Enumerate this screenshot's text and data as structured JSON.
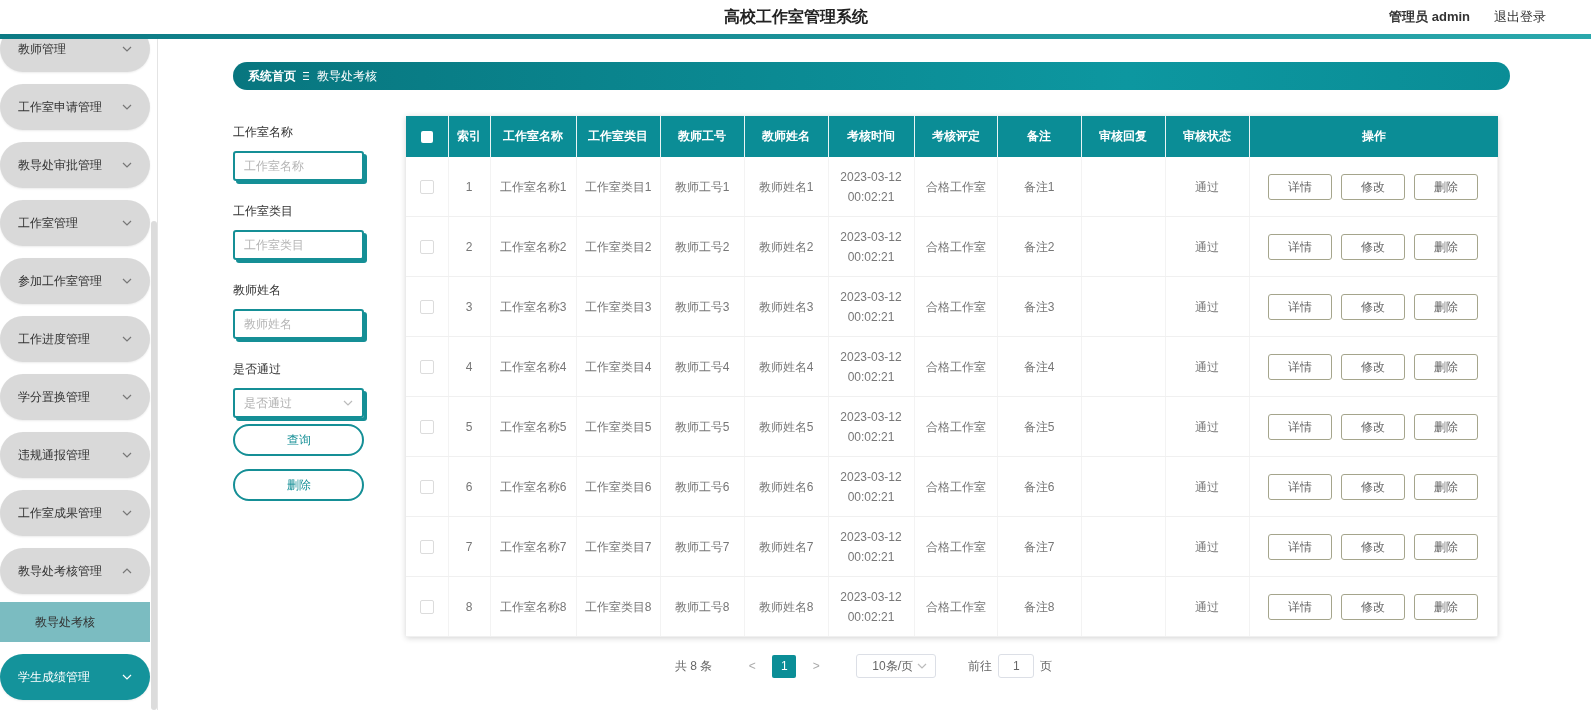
{
  "header": {
    "title": "高校工作室管理系统",
    "user": "管理员 admin",
    "logout": "退出登录"
  },
  "sidebar": {
    "items": [
      {
        "label": "教师管理",
        "expanded": false,
        "selected": false
      },
      {
        "label": "工作室申请管理",
        "expanded": false,
        "selected": false
      },
      {
        "label": "教导处审批管理",
        "expanded": false,
        "selected": false
      },
      {
        "label": "工作室管理",
        "expanded": false,
        "selected": false
      },
      {
        "label": "参加工作室管理",
        "expanded": false,
        "selected": false
      },
      {
        "label": "工作进度管理",
        "expanded": false,
        "selected": false
      },
      {
        "label": "学分置换管理",
        "expanded": false,
        "selected": false
      },
      {
        "label": "违规通报管理",
        "expanded": false,
        "selected": false
      },
      {
        "label": "工作室成果管理",
        "expanded": false,
        "selected": false
      },
      {
        "label": "教导处考核管理",
        "expanded": true,
        "selected": false,
        "children": [
          {
            "label": "教导处考核",
            "selected": true
          }
        ]
      },
      {
        "label": "学生成绩管理",
        "expanded": false,
        "selected": true
      }
    ]
  },
  "breadcrumb": [
    "系统首页",
    "教导处考核"
  ],
  "filters": [
    {
      "kind": "input",
      "label": "工作室名称",
      "placeholder": "工作室名称"
    },
    {
      "kind": "input",
      "label": "工作室类目",
      "placeholder": "工作室类目"
    },
    {
      "kind": "input",
      "label": "教师姓名",
      "placeholder": "教师姓名"
    },
    {
      "kind": "select",
      "label": "是否通过",
      "placeholder": "是否通过"
    }
  ],
  "filter_buttons": [
    "查询",
    "删除"
  ],
  "table": {
    "select_all": {
      "checked": false
    },
    "columns": [
      "索引",
      "工作室名称",
      "工作室类目",
      "教师工号",
      "教师姓名",
      "考核时间",
      "考核评定",
      "备注",
      "审核回复",
      "审核状态",
      "操作"
    ],
    "rows": [
      {
        "checked": false,
        "cells": [
          "1",
          "工作室名称1",
          "工作室类目1",
          "教师工号1",
          "教师姓名1",
          "2023-03-12 00:02:21",
          "合格工作室",
          "备注1",
          "",
          "通过"
        ],
        "actions": [
          "详情",
          "修改",
          "删除"
        ]
      },
      {
        "checked": false,
        "cells": [
          "2",
          "工作室名称2",
          "工作室类目2",
          "教师工号2",
          "教师姓名2",
          "2023-03-12 00:02:21",
          "合格工作室",
          "备注2",
          "",
          "通过"
        ],
        "actions": [
          "详情",
          "修改",
          "删除"
        ]
      },
      {
        "checked": false,
        "cells": [
          "3",
          "工作室名称3",
          "工作室类目3",
          "教师工号3",
          "教师姓名3",
          "2023-03-12 00:02:21",
          "合格工作室",
          "备注3",
          "",
          "通过"
        ],
        "actions": [
          "详情",
          "修改",
          "删除"
        ]
      },
      {
        "checked": false,
        "cells": [
          "4",
          "工作室名称4",
          "工作室类目4",
          "教师工号4",
          "教师姓名4",
          "2023-03-12 00:02:21",
          "合格工作室",
          "备注4",
          "",
          "通过"
        ],
        "actions": [
          "详情",
          "修改",
          "删除"
        ]
      },
      {
        "checked": false,
        "cells": [
          "5",
          "工作室名称5",
          "工作室类目5",
          "教师工号5",
          "教师姓名5",
          "2023-03-12 00:02:21",
          "合格工作室",
          "备注5",
          "",
          "通过"
        ],
        "actions": [
          "详情",
          "修改",
          "删除"
        ]
      },
      {
        "checked": false,
        "cells": [
          "6",
          "工作室名称6",
          "工作室类目6",
          "教师工号6",
          "教师姓名6",
          "2023-03-12 00:02:21",
          "合格工作室",
          "备注6",
          "",
          "通过"
        ],
        "actions": [
          "详情",
          "修改",
          "删除"
        ]
      },
      {
        "checked": false,
        "cells": [
          "7",
          "工作室名称7",
          "工作室类目7",
          "教师工号7",
          "教师姓名7",
          "2023-03-12 00:02:21",
          "合格工作室",
          "备注7",
          "",
          "通过"
        ],
        "actions": [
          "详情",
          "修改",
          "删除"
        ]
      },
      {
        "checked": false,
        "cells": [
          "8",
          "工作室名称8",
          "工作室类目8",
          "教师工号8",
          "教师姓名8",
          "2023-03-12 00:02:21",
          "合格工作室",
          "备注8",
          "",
          "通过"
        ],
        "actions": [
          "详情",
          "修改",
          "删除"
        ]
      }
    ]
  },
  "pagination": {
    "total": "共 8 条",
    "prev": "<",
    "pages": [
      {
        "label": "1",
        "selected": true
      }
    ],
    "next": ">",
    "page_size": "10条/页",
    "goto_label": "前往",
    "goto_value": "1",
    "goto_suffix": "页"
  }
}
